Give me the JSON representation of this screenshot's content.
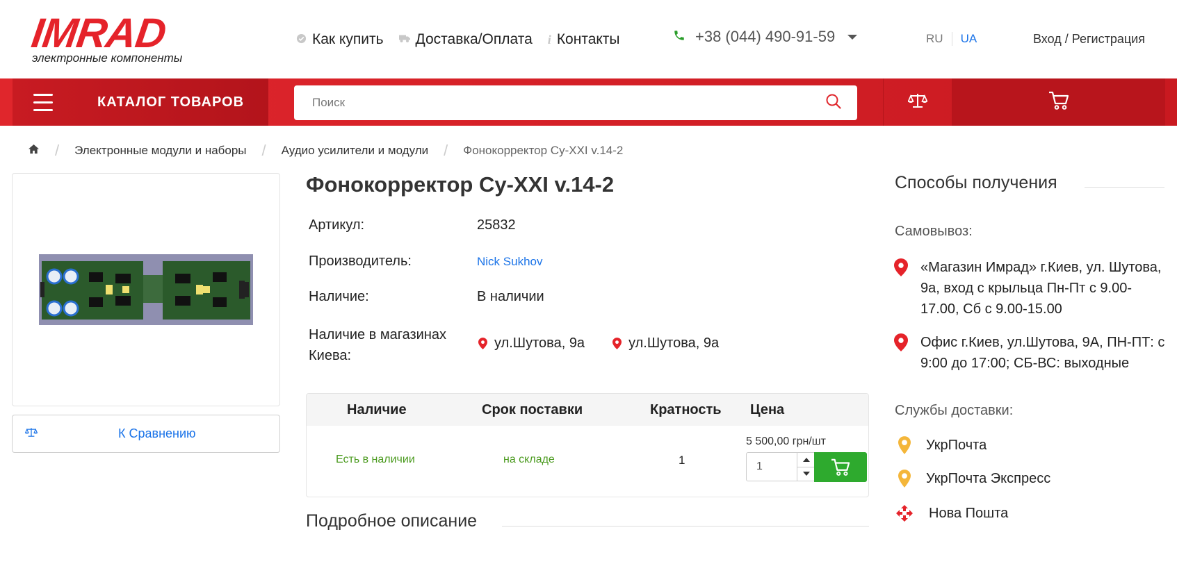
{
  "brand": {
    "name": "IMRAD",
    "tagline": "электронные компоненты"
  },
  "topnav": [
    {
      "label": "Как купить",
      "icon": "check-circle-icon"
    },
    {
      "label": "Доставка/Оплата",
      "icon": "truck-icon"
    },
    {
      "label": "Контакты",
      "icon": "info-icon"
    }
  ],
  "phone": "+38 (044) 490-91-59",
  "lang": {
    "ru": "RU",
    "ua": "UA",
    "active": "UA"
  },
  "login_label": "Вход / Регистрация",
  "catalog_label": "КАТАЛОГ ТОВАРОВ",
  "search": {
    "placeholder": "Поиск",
    "value": ""
  },
  "breadcrumb": [
    "Электронные модули и наборы",
    "Аудио усилители и модули",
    "Фонокорректор Cy-XXI v.14-2"
  ],
  "compare_label": "К Сравнению",
  "product": {
    "title": "Фонокорректор Cy-XXI v.14-2",
    "specs": {
      "article_label": "Артикул:",
      "article": "25832",
      "manufacturer_label": "Производитель:",
      "manufacturer": "Nick Sukhov",
      "availability_label": "Наличие:",
      "availability": "В наличии",
      "stores_label_1": "Наличие в магазинах",
      "stores_label_2": "Киева:",
      "stores": [
        "ул.Шутова, 9а",
        "ул.Шутова, 9а"
      ]
    }
  },
  "offer_table": {
    "headers": [
      "Наличие",
      "Срок поставки",
      "Кратность",
      "Цена"
    ],
    "row": {
      "availability": "Есть в наличии",
      "delivery": "на складе",
      "multiplicity": "1",
      "price": "5 500,00 грн/шт",
      "qty": "1"
    }
  },
  "description_title": "Подробное описание",
  "side": {
    "title": "Способы получения",
    "pickup_label": "Самовывоз:",
    "pickup": [
      [
        "«Магазин Имрад» г.Киев, ул. Шутова,",
        "9а, вход с крыльца Пн-Пт с 9.00-",
        "17.00, Сб с 9.00-15.00"
      ],
      [
        "Офис г.Киев, ул.Шутова, 9А, ПН-ПТ: с",
        "9:00 до 17:00; СБ-ВС: выходные"
      ]
    ],
    "delivery_label": "Службы доставки:",
    "delivery": [
      "УкрПочта",
      "УкрПочта Экспресс",
      "Нова Пошта"
    ]
  },
  "colors": {
    "brand_red": "#e0262c",
    "link_blue": "#1a73e8",
    "green": "#2eaa2e",
    "pin_red": "#e5232a",
    "pin_yellow": "#f4b63a"
  }
}
